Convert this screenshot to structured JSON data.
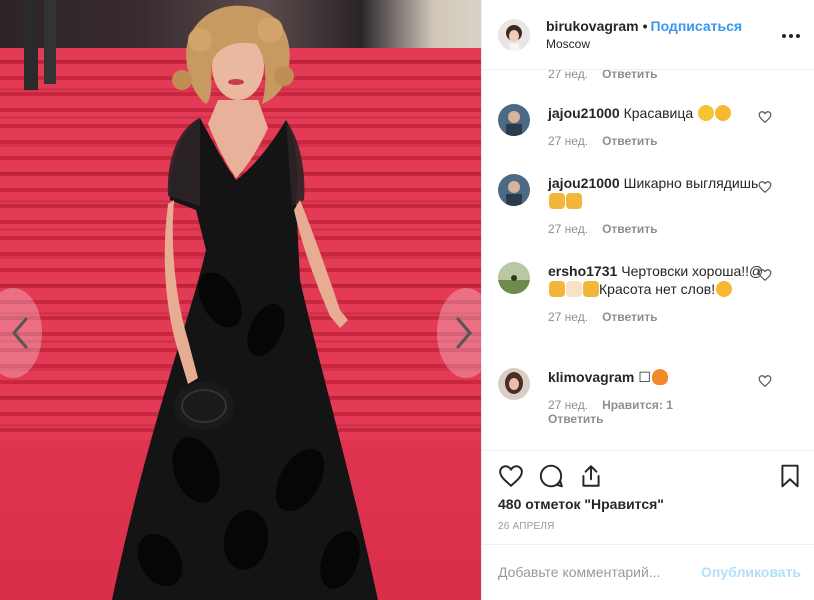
{
  "header": {
    "username": "birukovagram",
    "separator": "•",
    "follow_label": "Подписаться",
    "location": "Moscow"
  },
  "comments_top_meta": {
    "time": "27 нед.",
    "reply": "Ответить"
  },
  "comments": [
    {
      "username": "jajou21000",
      "text": "Красавица",
      "emoji": [
        "heart-eyes-emoji",
        "kiss-emoji"
      ],
      "time": "27 нед.",
      "reply": "Ответить",
      "likes": ""
    },
    {
      "username": "jajou21000",
      "text": "Шикарно выглядишь",
      "emoji": [
        "strong-arm-emoji",
        "thumbs-up-emoji"
      ],
      "time": "27 нед.",
      "reply": "Ответить",
      "likes": ""
    },
    {
      "username": "ersho1731",
      "text": "Чертовски хороша!!@",
      "text_after": "Красота нет слов!",
      "emoji": [
        "thumbs-up-emoji",
        "thumbs-up-emoji",
        "thumbs-up-emoji"
      ],
      "time": "27 нед.",
      "reply": "Ответить",
      "likes": ""
    },
    {
      "username": "klimovagram",
      "text": "☐",
      "emoji": [
        "fire-emoji"
      ],
      "time": "27 нед.",
      "reply": "Ответить",
      "likes": "Нравится: 1"
    }
  ],
  "actions": {
    "likes_count": "480 отметок \"Нравится\"",
    "date": "26 АПРЕЛЯ"
  },
  "add_comment": {
    "placeholder": "Добавьте комментарий...",
    "post_label": "Опубликовать"
  },
  "colors": {
    "accent": "#3897f0",
    "post_disabled": "#b2dffc",
    "carpet": "#e33a55"
  },
  "icons": [
    "more-icon",
    "heart-icon",
    "comment-icon",
    "share-icon",
    "bookmark-icon",
    "chevron-left-icon",
    "chevron-right-icon"
  ]
}
